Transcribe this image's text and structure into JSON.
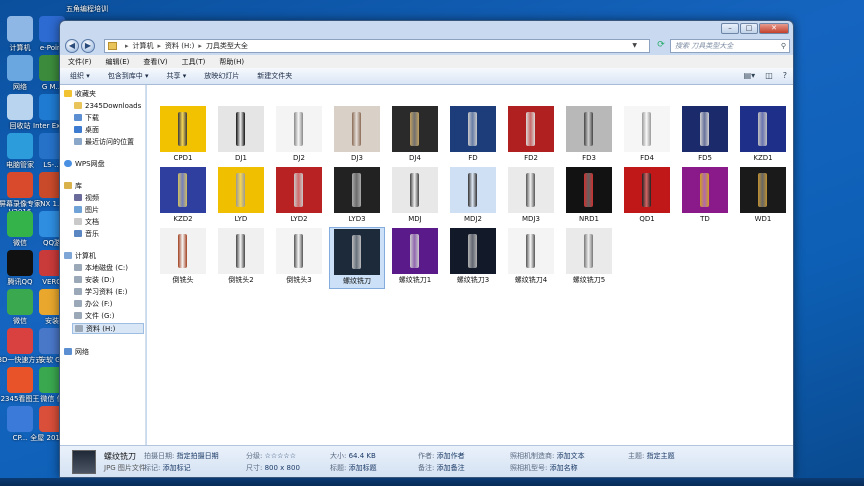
{
  "desktop": {
    "icons": [
      {
        "name": "desk-icon-computer",
        "label": "计算机",
        "color": "#8fb7e6"
      },
      {
        "name": "desk-icon-network",
        "label": "网络",
        "color": "#6aa6e0"
      },
      {
        "name": "desk-icon-recycle",
        "label": "回收站",
        "color": "#b8d4ef"
      },
      {
        "name": "desk-icon-pcmanager",
        "label": "电脑管家",
        "color": "#2d9cdb"
      },
      {
        "name": "desk-icon-recorder",
        "label": "屏幕录像专家V2016",
        "color": "#d84a2b"
      },
      {
        "name": "desk-icon-wechat",
        "label": "微信",
        "color": "#34b34a"
      },
      {
        "name": "desk-icon-qq",
        "label": "腾讯QQ",
        "color": "#111"
      },
      {
        "name": "desk-icon-pic",
        "label": "微信",
        "color": "#3aa84f"
      },
      {
        "name": "desk-icon-3d",
        "label": "3D一快速方式",
        "color": "#d94141"
      },
      {
        "name": "desk-icon-2345",
        "label": "2345看图王",
        "color": "#e8532a"
      },
      {
        "name": "desk-icon-cp",
        "label": "CP...",
        "color": "#3b7ad9"
      }
    ],
    "icons2": [
      {
        "name": "desk-icon-epoint",
        "label": "e-Point",
        "color": "#2d6ad1"
      },
      {
        "name": "desk-icon-gm",
        "label": "G M...",
        "color": "#3c8b3c"
      },
      {
        "name": "desk-icon-inter",
        "label": "Inter Explo",
        "color": "#1f7bd1"
      },
      {
        "name": "desk-icon-ls",
        "label": "LS-...",
        "color": "#2672c9"
      },
      {
        "name": "desk-icon-nx",
        "label": "NX 1...",
        "color": "#c84a2a"
      },
      {
        "name": "desk-icon-qqgame",
        "label": "QQ游",
        "color": "#2f8ee0"
      },
      {
        "name": "desk-icon-vero",
        "label": "VERO",
        "color": "#c93a3a"
      },
      {
        "name": "desk-icon-safe",
        "label": "安装",
        "color": "#e9a82d"
      },
      {
        "name": "desk-icon-vs",
        "label": "安软 GS",
        "color": "#4a78c9"
      },
      {
        "name": "desk-icon-wx",
        "label": "微信 信",
        "color": "#3aa84f"
      },
      {
        "name": "desk-icon-whole",
        "label": "全屋 2016(...",
        "color": "#d94f3a"
      }
    ],
    "top_label": "五角编程培训"
  },
  "window": {
    "address": {
      "parts": [
        "计算机",
        "资料 (H:)",
        "刀具类型大全"
      ]
    },
    "search_placeholder": "搜索 刀具类型大全",
    "menu": [
      "文件(F)",
      "编辑(E)",
      "查看(V)",
      "工具(T)",
      "帮助(H)"
    ],
    "toolbar": [
      "组织 ▾",
      "包含到库中 ▾",
      "共享 ▾",
      "放映幻灯片",
      "新建文件夹"
    ],
    "nav": {
      "favorites": "收藏夹",
      "fav_items": [
        "2345Downloads",
        "下载",
        "桌面",
        "最近访问的位置"
      ],
      "wps": "WPS网盘",
      "library": "库",
      "lib_items": [
        "视频",
        "图片",
        "文档",
        "音乐"
      ],
      "computer": "计算机",
      "drives": [
        "本地磁盘 (C:)",
        "安装 (D:)",
        "学习资料 (E:)",
        "办公 (F:)",
        "文件 (G:)",
        "资料 (H:)"
      ],
      "network": "网络"
    },
    "files": [
      {
        "label": "CPD1",
        "bg": "#f2c200",
        "fg": "#3a3a3a"
      },
      {
        "label": "DJ1",
        "bg": "#e5e5e5",
        "fg": "#111"
      },
      {
        "label": "DJ2",
        "bg": "#f4f4f4",
        "fg": "#888"
      },
      {
        "label": "DJ3",
        "bg": "#d9d0c8",
        "fg": "#8a6b55"
      },
      {
        "label": "DJ4",
        "bg": "#2a2a2a",
        "fg": "#c0a060"
      },
      {
        "label": "FD",
        "bg": "#1c3d7a",
        "fg": "#c8c8c8"
      },
      {
        "label": "FD2",
        "bg": "#b02020",
        "fg": "#d8d8d8"
      },
      {
        "label": "FD3",
        "bg": "#b8b8b8",
        "fg": "#444"
      },
      {
        "label": "FD4",
        "bg": "#f6f6f6",
        "fg": "#999"
      },
      {
        "label": "FD5",
        "bg": "#1a2a6a",
        "fg": "#d0d0d0"
      },
      {
        "label": "KZD1",
        "bg": "#1e2f8a",
        "fg": "#c0c0c0"
      },
      {
        "label": "KZD2",
        "bg": "#2f3fa0",
        "fg": "#d0c060"
      },
      {
        "label": "LYD",
        "bg": "#f0c000",
        "fg": "#999"
      },
      {
        "label": "LYD2",
        "bg": "#b82222",
        "fg": "#c8c8c8"
      },
      {
        "label": "LYD3",
        "bg": "#222",
        "fg": "#aaa"
      },
      {
        "label": "MDJ",
        "bg": "#e8e8e8",
        "fg": "#444"
      },
      {
        "label": "MDJ2",
        "bg": "#cfe0f4",
        "fg": "#333"
      },
      {
        "label": "MDJ3",
        "bg": "#eaeaea",
        "fg": "#555"
      },
      {
        "label": "NRD1",
        "bg": "#121212",
        "fg": "#d03030"
      },
      {
        "label": "QD1",
        "bg": "#c01818",
        "fg": "#222"
      },
      {
        "label": "TD",
        "bg": "#8a1a8a",
        "fg": "#d0a020"
      },
      {
        "label": "WD1",
        "bg": "#1a1a1a",
        "fg": "#c09030"
      },
      {
        "label": "倒铣头",
        "bg": "#f2f2f2",
        "fg": "#a04020"
      },
      {
        "label": "倒铣头2",
        "bg": "#f0f0f0",
        "fg": "#444"
      },
      {
        "label": "倒铣头3",
        "bg": "#f4f4f4",
        "fg": "#555"
      },
      {
        "label": "螺纹铣刀",
        "bg": "#1c2a3a",
        "fg": "#bbb",
        "selected": true
      },
      {
        "label": "螺纹铣刀1",
        "bg": "#5a1a8a",
        "fg": "#ccc"
      },
      {
        "label": "螺纹铣刀3",
        "bg": "#121a2a",
        "fg": "#b0b0b0"
      },
      {
        "label": "螺纹铣刀4",
        "bg": "#f4f4f4",
        "fg": "#555"
      },
      {
        "label": "螺纹铣刀5",
        "bg": "#eaeaea",
        "fg": "#777"
      }
    ],
    "status": {
      "name": "螺纹铣刀",
      "type": "JPG 图片文件",
      "date_k": "拍摄日期:",
      "date_v": "指定拍摄日期",
      "tag_k": "标记:",
      "tag_v": "添加标记",
      "rating_k": "分级:",
      "rating_v": "☆☆☆☆☆",
      "dim_k": "尺寸:",
      "dim_v": "800 x 800",
      "size_k": "大小:",
      "size_v": "64.4 KB",
      "title_k": "标题:",
      "title_v": "添加标题",
      "author_k": "作者:",
      "author_v": "添加作者",
      "comment_k": "备注:",
      "comment_v": "添加备注",
      "maker_k": "照相机制造商:",
      "maker_v": "添加文本",
      "model_k": "照相机型号:",
      "model_v": "添加名称",
      "subject_k": "主题:",
      "subject_v": "指定主题"
    }
  }
}
